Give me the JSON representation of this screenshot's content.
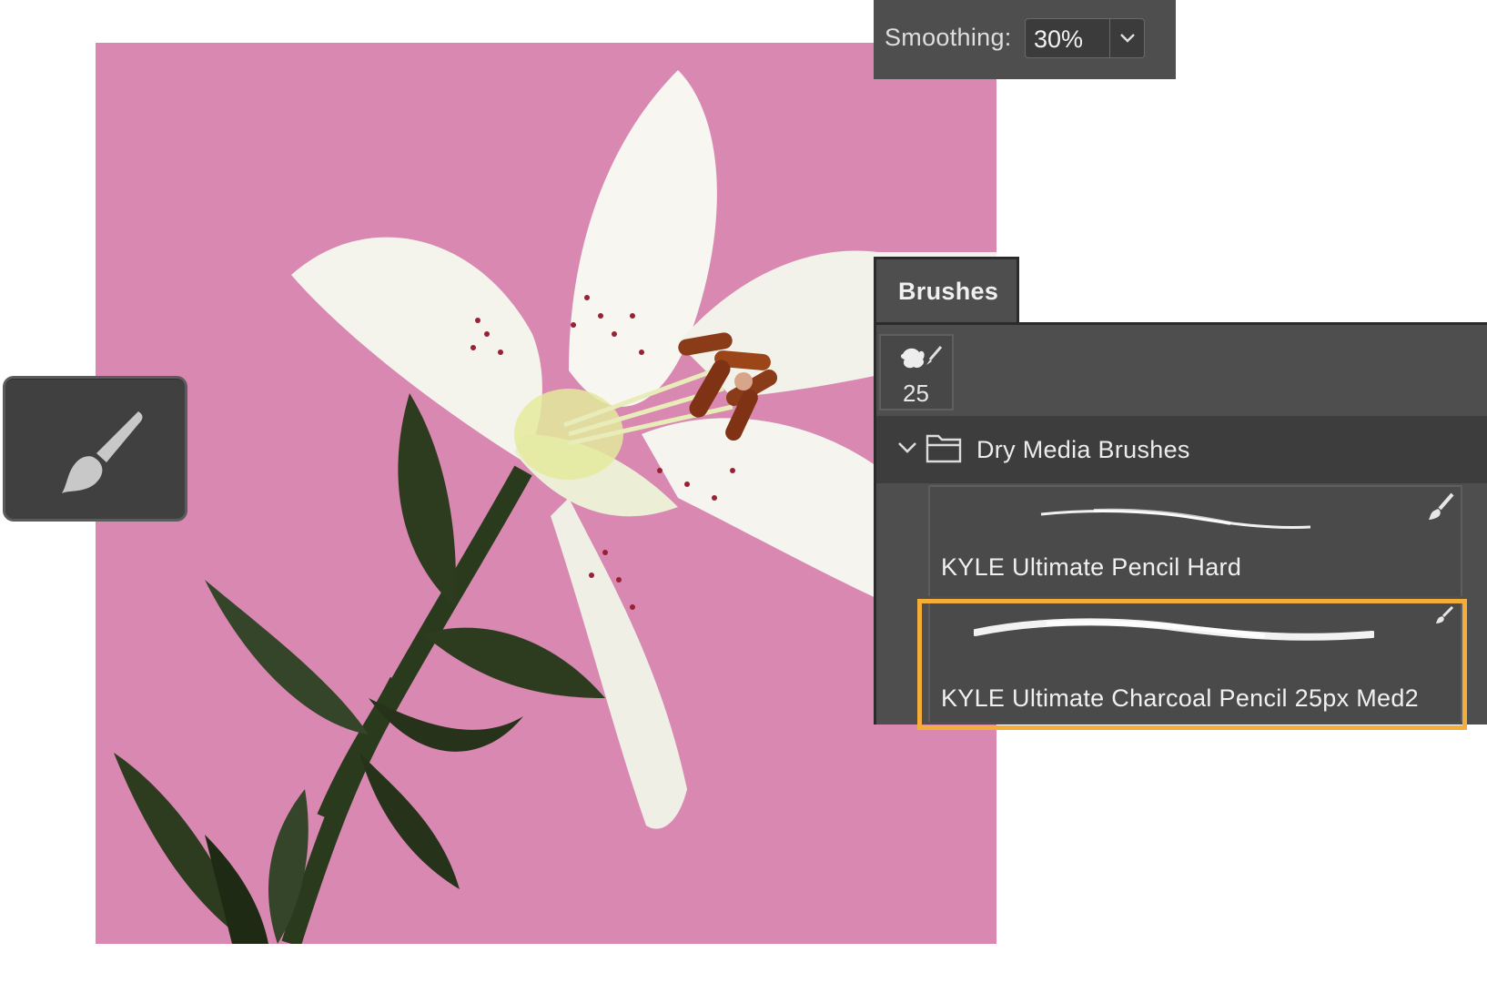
{
  "canvas": {
    "background_color": "#d888b1",
    "subject": "white-lily-image"
  },
  "tool": {
    "icon": "brush-icon",
    "selected": true
  },
  "options_bar": {
    "smoothing_label": "Smoothing:",
    "smoothing_value": "30%",
    "dropdown_icon": "chevron-down-icon"
  },
  "brushes_panel": {
    "tab_label": "Brushes",
    "brush_size": "25",
    "group": {
      "label": "Dry Media Brushes",
      "expanded": true,
      "icon": "folder-icon"
    },
    "items": [
      {
        "name": "KYLE Ultimate Pencil Hard",
        "selected": false
      },
      {
        "name": "KYLE Ultimate Charcoal Pencil 25px Med2",
        "selected": true
      }
    ],
    "highlight_color": "#f4ad37"
  }
}
